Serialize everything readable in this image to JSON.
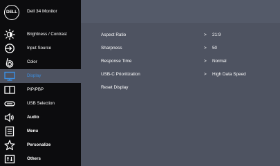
{
  "header": {
    "logo_text": "DELL",
    "monitor_name": "Dell 34 Monitor"
  },
  "menu": [
    {
      "label": "Brightness / Contrast",
      "icon": "brightness-icon",
      "selected": false
    },
    {
      "label": "Input Source",
      "icon": "input-source-icon",
      "selected": false
    },
    {
      "label": "Color",
      "icon": "color-icon",
      "selected": false
    },
    {
      "label": "Display",
      "icon": "display-icon",
      "selected": true
    },
    {
      "label": "PIP/PBP",
      "icon": "pip-pbp-icon",
      "selected": false
    },
    {
      "label": "USB Selection",
      "icon": "usb-icon",
      "selected": false
    },
    {
      "label": "Audio",
      "icon": "speaker-icon",
      "selected": false
    },
    {
      "label": "Menu",
      "icon": "menu-icon",
      "selected": false
    },
    {
      "label": "Personalize",
      "icon": "star-icon",
      "selected": false
    },
    {
      "label": "Others",
      "icon": "others-icon",
      "selected": false
    }
  ],
  "settings": [
    {
      "name": "Aspect Ratio",
      "chevron": ">",
      "value": "21:9"
    },
    {
      "name": "Sharpness",
      "chevron": ">",
      "value": "50"
    },
    {
      "name": "Response Time",
      "chevron": ">",
      "value": "Normal"
    },
    {
      "name": "USB-C Prioritization",
      "chevron": ">",
      "value": "High Data Speed"
    },
    {
      "name": "Reset Display",
      "chevron": "",
      "value": ""
    }
  ],
  "colors": {
    "sidebar_bg": "#0c0c0e",
    "panel_bg": "#4e5361",
    "selected_label": "#3c8ee0",
    "text": "#ffffff"
  }
}
